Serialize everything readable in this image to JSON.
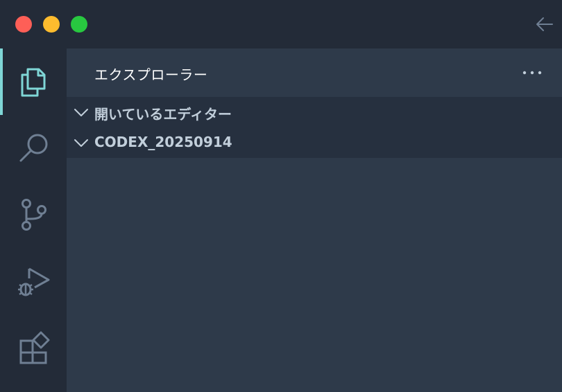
{
  "window": {
    "traffic_lights": {
      "close_color": "#fe5f57",
      "minimize_color": "#febc2e",
      "maximize_color": "#28c840"
    },
    "back_icon": "arrow-left-icon"
  },
  "activity_bar": {
    "accent_color": "#7fd6d6",
    "items": [
      {
        "icon": "explorer-icon",
        "active": true
      },
      {
        "icon": "search-icon",
        "active": false
      },
      {
        "icon": "source-control-icon",
        "active": false
      },
      {
        "icon": "run-debug-icon",
        "active": false
      },
      {
        "icon": "extensions-icon",
        "active": false
      }
    ]
  },
  "sidebar": {
    "title": "エクスプローラー",
    "more_icon": "ellipsis-icon",
    "sections": [
      {
        "label": "開いているエディター",
        "expanded": true
      },
      {
        "label": "CODEX_20250914",
        "expanded": true
      }
    ]
  }
}
